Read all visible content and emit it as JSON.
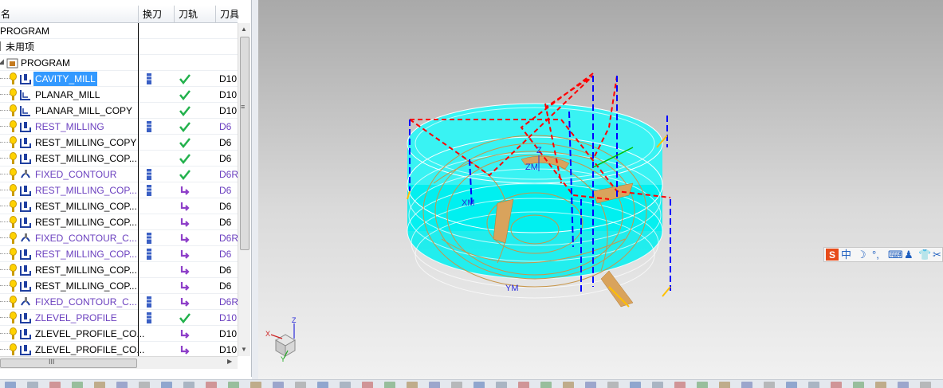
{
  "columns": {
    "name": "名",
    "tool_change": "换刀",
    "toolpath": "刀轨",
    "tool": "刀具"
  },
  "root_rows": [
    {
      "label": "PROGRAM"
    },
    {
      "label": "未用项"
    },
    {
      "label": "PROGRAM"
    }
  ],
  "operations": [
    {
      "name": "CAVITY_MILL",
      "tool_change": true,
      "toolpath": "check",
      "tool": "D10",
      "color": "black",
      "selected": true,
      "icon": "cavity-mill-icon"
    },
    {
      "name": "PLANAR_MILL",
      "tool_change": false,
      "toolpath": "check",
      "tool": "D10",
      "color": "black",
      "selected": false,
      "icon": "planar-mill-icon"
    },
    {
      "name": "PLANAR_MILL_COPY",
      "tool_change": false,
      "toolpath": "check",
      "tool": "D10",
      "color": "black",
      "selected": false,
      "icon": "planar-mill-icon"
    },
    {
      "name": "REST_MILLING",
      "tool_change": true,
      "toolpath": "check",
      "tool": "D6",
      "color": "purple",
      "selected": false,
      "icon": "cavity-mill-icon"
    },
    {
      "name": "REST_MILLING_COPY",
      "tool_change": false,
      "toolpath": "check",
      "tool": "D6",
      "color": "black",
      "selected": false,
      "icon": "cavity-mill-icon"
    },
    {
      "name": "REST_MILLING_COP...",
      "tool_change": false,
      "toolpath": "check",
      "tool": "D6",
      "color": "black",
      "selected": false,
      "icon": "cavity-mill-icon"
    },
    {
      "name": "FIXED_CONTOUR",
      "tool_change": true,
      "toolpath": "check",
      "tool": "D6R",
      "color": "purple",
      "selected": false,
      "icon": "fixed-contour-icon"
    },
    {
      "name": "REST_MILLING_COP...",
      "tool_change": true,
      "toolpath": "regen",
      "tool": "D6",
      "color": "purple",
      "selected": false,
      "icon": "cavity-mill-icon"
    },
    {
      "name": "REST_MILLING_COP...",
      "tool_change": false,
      "toolpath": "regen",
      "tool": "D6",
      "color": "black",
      "selected": false,
      "icon": "cavity-mill-icon"
    },
    {
      "name": "REST_MILLING_COP...",
      "tool_change": false,
      "toolpath": "regen",
      "tool": "D6",
      "color": "black",
      "selected": false,
      "icon": "cavity-mill-icon"
    },
    {
      "name": "FIXED_CONTOUR_C...",
      "tool_change": true,
      "toolpath": "regen",
      "tool": "D6R",
      "color": "purple",
      "selected": false,
      "icon": "fixed-contour-icon"
    },
    {
      "name": "REST_MILLING_COP...",
      "tool_change": true,
      "toolpath": "regen",
      "tool": "D6",
      "color": "purple",
      "selected": false,
      "icon": "cavity-mill-icon"
    },
    {
      "name": "REST_MILLING_COP...",
      "tool_change": false,
      "toolpath": "regen",
      "tool": "D6",
      "color": "black",
      "selected": false,
      "icon": "cavity-mill-icon"
    },
    {
      "name": "REST_MILLING_COP...",
      "tool_change": false,
      "toolpath": "regen",
      "tool": "D6",
      "color": "black",
      "selected": false,
      "icon": "cavity-mill-icon"
    },
    {
      "name": "FIXED_CONTOUR_C...",
      "tool_change": true,
      "toolpath": "regen",
      "tool": "D6R",
      "color": "purple",
      "selected": false,
      "icon": "fixed-contour-icon"
    },
    {
      "name": "ZLEVEL_PROFILE",
      "tool_change": true,
      "toolpath": "check",
      "tool": "D10",
      "color": "purple",
      "selected": false,
      "icon": "cavity-mill-icon"
    },
    {
      "name": "ZLEVEL_PROFILE_CO...",
      "tool_change": false,
      "toolpath": "regen",
      "tool": "D10",
      "color": "black",
      "selected": false,
      "icon": "cavity-mill-icon"
    },
    {
      "name": "ZLEVEL_PROFILE_CO...",
      "tool_change": false,
      "toolpath": "regen",
      "tool": "D10",
      "color": "black",
      "selected": false,
      "icon": "cavity-mill-icon"
    }
  ],
  "scroll": {
    "h_grip": "III"
  },
  "viewport": {
    "axis_labels": {
      "z": "Z",
      "x": "X",
      "y": "Y",
      "zm": "ZM",
      "ym": "YM",
      "xm": "XM"
    }
  },
  "ime": {
    "logo": "S",
    "mode": "中"
  },
  "colors": {
    "selected_row": "#3399ff",
    "purple_text": "#6a3fbf",
    "check_green": "#22b14c",
    "regen_purple": "#8e3fc9",
    "part_cyan": "#00f0f0",
    "toolpath_red": "#ff0000",
    "toolpath_blue": "#0000ff",
    "toolpath_tan": "#c8964a"
  }
}
